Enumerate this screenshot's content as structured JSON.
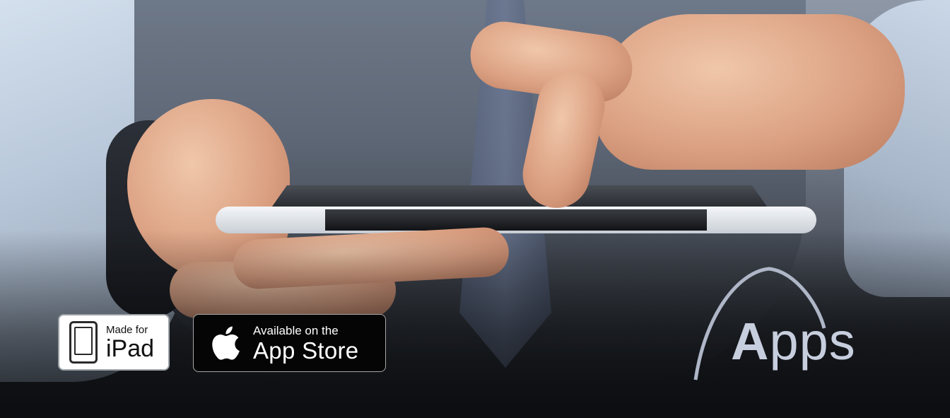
{
  "badges": {
    "ipad": {
      "line1": "Made for",
      "line2": "iPad",
      "icon": "ipad-icon"
    },
    "app_store": {
      "line1": "Available on the",
      "line2": "App Store",
      "icon": "apple-icon"
    }
  },
  "logo": {
    "first_letter": "A",
    "rest": "pps",
    "color": "#c7cede"
  },
  "colors": {
    "badge_dark": "#050505",
    "badge_light": "#ffffff"
  }
}
